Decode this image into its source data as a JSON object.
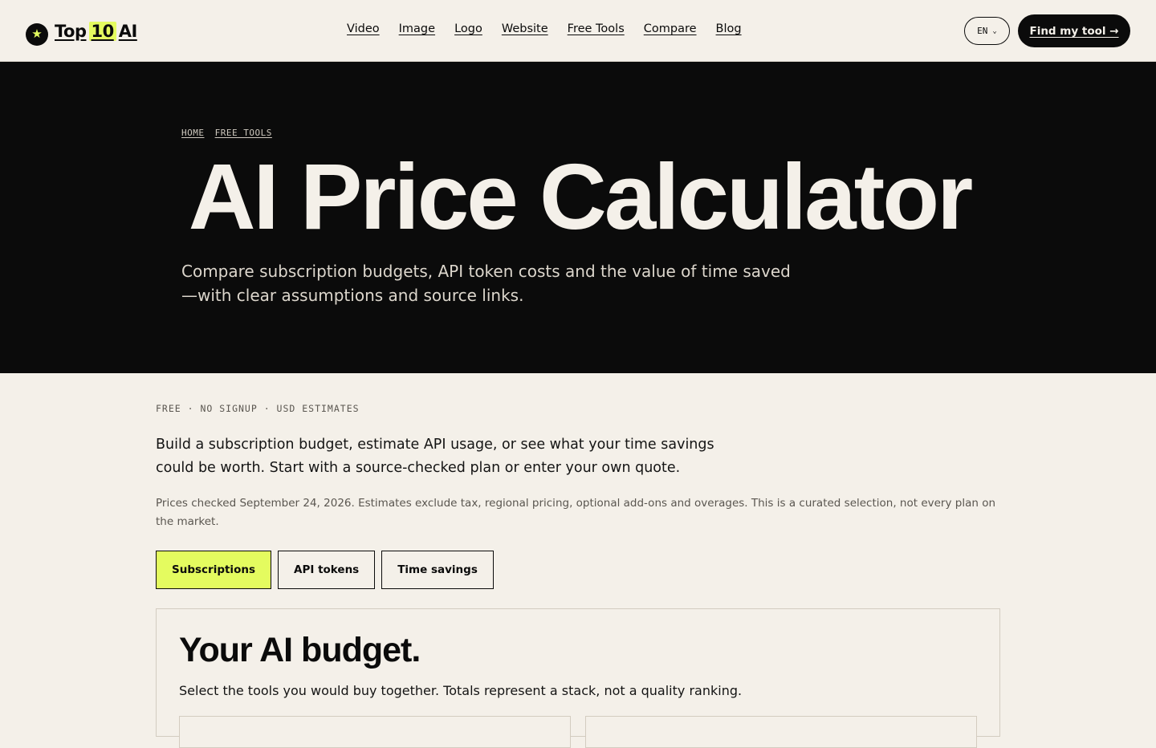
{
  "header": {
    "logo": {
      "icon": "star-icon",
      "word1": "Top",
      "number": "10",
      "word2": "AI"
    },
    "nav": [
      "Video",
      "Image",
      "Logo",
      "Website",
      "Free Tools",
      "Compare",
      "Blog"
    ],
    "language": "EN",
    "cta_label": "Find my tool →"
  },
  "hero": {
    "breadcrumb": [
      "HOME",
      "FREE TOOLS"
    ],
    "title": "AI Price Calculator",
    "subtitle": "Compare subscription budgets, API token costs and the value of time saved—with clear assumptions and source links."
  },
  "main": {
    "eyebrow": "FREE · NO SIGNUP · USD ESTIMATES",
    "intro": "Build a subscription budget, estimate API usage, or see what your time savings could be worth. Start with a source-checked plan or enter your own quote.",
    "note": "Prices checked September 24, 2026. Estimates exclude tax, regional pricing, optional add-ons and overages. This is a curated selection, not every plan on the market.",
    "tabs": [
      {
        "label": "Subscriptions",
        "active": true
      },
      {
        "label": "API tokens",
        "active": false
      },
      {
        "label": "Time savings",
        "active": false
      }
    ],
    "card": {
      "title": "Your AI budget.",
      "subtitle": "Select the tools you would buy together. Totals represent a stack, not a quality ranking."
    }
  },
  "colors": {
    "accent": "#e4fb5f",
    "dark": "#0b0b0b",
    "background": "#f4f0e9"
  }
}
